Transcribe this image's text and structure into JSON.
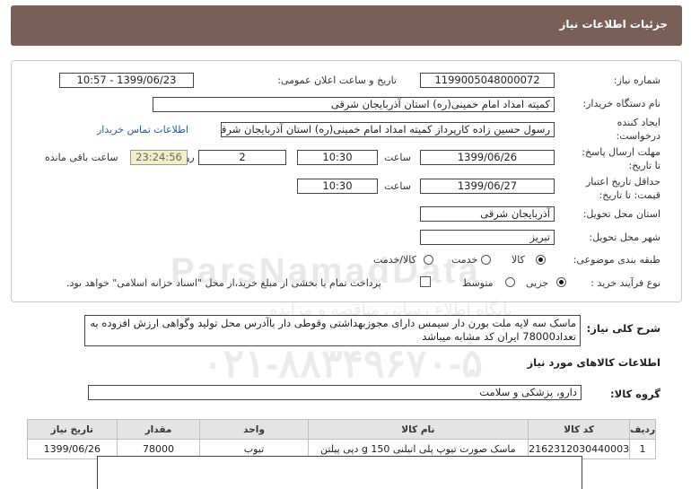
{
  "header": {
    "title": "جزئیات اطلاعات نیاز"
  },
  "need_number": {
    "label": "شماره نیاز:",
    "value": "1199005048000072"
  },
  "announce": {
    "label": "تاریخ و ساعت اعلان عمومی:",
    "value": "1399/06/23 - 10:57"
  },
  "buyer": {
    "label": "نام دستگاه خریدار:",
    "value": "کمیته امداد امام خمینی(ره) استان آذربایجان شرقی"
  },
  "creator": {
    "label_line1": "ایجاد کننده",
    "label_line2": "درخواست:",
    "value": "رسول  حسین زاده  کارپرداز کمیته امداد امام خمینی(ره) استان آذربایجان شرقی",
    "contact_link": "اطلاعات تماس خریدار"
  },
  "deadline": {
    "label_line1": "مهلت ارسال پاسخ:",
    "label_line2": "تا تاریخ:",
    "date": "1399/06/26",
    "time_label": "ساعت",
    "time": "10:30",
    "days": "2",
    "days_label": "روز و",
    "remaining": "23:24:56",
    "remaining_label": "ساعت باقی مانده"
  },
  "validity": {
    "label_line1": "حداقل تاریخ اعتبار",
    "label_line2": "قیمت: تا تاریخ:",
    "date": "1399/06/27",
    "time_label": "ساعت",
    "time": "10:30"
  },
  "province": {
    "label": "استان محل تحویل:",
    "value": "آذربایجان شرقی"
  },
  "city": {
    "label": "شهر محل تحویل:",
    "value": "تبریز"
  },
  "category": {
    "label": "طبقه بندی موضوعی:",
    "options": [
      "کالا",
      "خدمت",
      "کالا/خدمت"
    ],
    "selected": "کالا"
  },
  "process": {
    "label": "نوع فرآیند خرید :",
    "options": [
      "جزیی",
      "متوسط"
    ],
    "selected": "جزیی",
    "note": "پرداخت تمام یا بخشی از مبلغ خرید،از محل \"اسناد خزانه اسلامی\" خواهد بود."
  },
  "description": {
    "label": "شرح کلی نیاز:",
    "value": "ماسک سه لایه ملت بورن دار سیمس دارای مجوزبهداشتی وقوطی دار باآدرس محل تولید  وگواهی ارزش افزوده به تعداد78000 ایران کد مشابه میباشد"
  },
  "goods_info": {
    "title": "اطلاعات کالاهای مورد نیاز"
  },
  "goods_group": {
    "label": "گروه کالا:",
    "value": "دارو، پزشکی و سلامت"
  },
  "table": {
    "headers": [
      "ردیف",
      "کد کالا",
      "نام کالا",
      "واحد",
      "مقدار",
      "تاریخ نیاز"
    ],
    "rows": [
      [
        "1",
        "2162312030440003",
        "ماسک صورت تیوپ پلی اتیلنی 150 g دپی پیلتن",
        "تیوب",
        "78000",
        "1399/06/26"
      ]
    ]
  },
  "watermark": {
    "line1": "ParsNamadData",
    "line2": "پایگاه اطلاع رسانی مناقصه و مزایده",
    "line3": "۰۲۱-۸۸۳۴۹۶۷۰-۵"
  }
}
